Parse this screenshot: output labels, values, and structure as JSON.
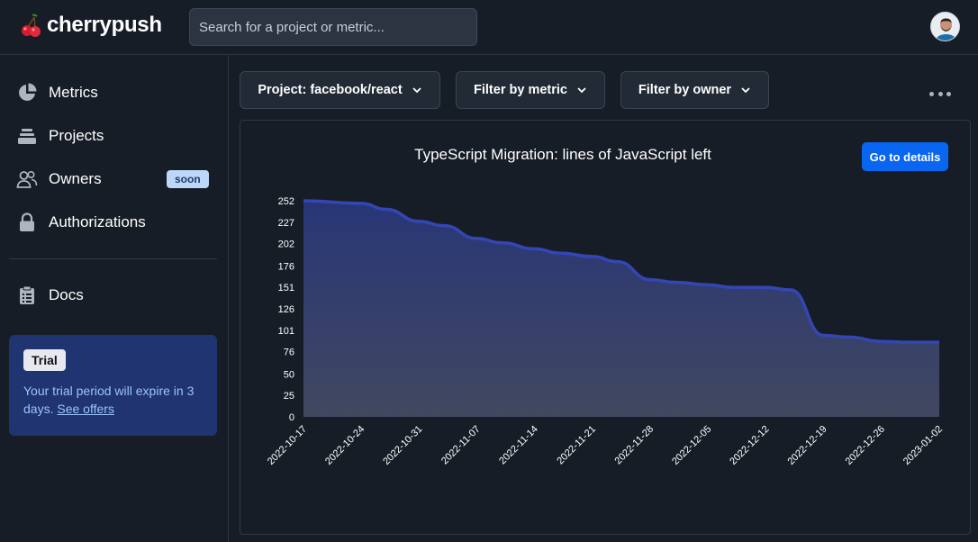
{
  "header": {
    "brand": "cherrypush",
    "search_placeholder": "Search for a project or metric..."
  },
  "sidebar": {
    "items": [
      {
        "label": "Metrics",
        "icon": "pie-chart-icon"
      },
      {
        "label": "Projects",
        "icon": "stack-icon"
      },
      {
        "label": "Owners",
        "icon": "users-icon",
        "badge": "soon"
      },
      {
        "label": "Authorizations",
        "icon": "lock-icon"
      },
      {
        "label": "Docs",
        "icon": "clipboard-icon"
      }
    ],
    "trial": {
      "badge": "Trial",
      "text": "Your trial period will expire in 3 days.",
      "link": "See offers"
    }
  },
  "filters": {
    "project": "Project: facebook/react",
    "metric": "Filter by metric",
    "owner": "Filter by owner"
  },
  "card": {
    "details_button": "Go to details"
  },
  "colors": {
    "accent": "#0866f0",
    "line": "#3446b4",
    "area_top": "#283677",
    "area_bottom": "#414860"
  },
  "chart_data": {
    "type": "area",
    "title": "TypeScript Migration: lines of JavaScript left",
    "xlabel": "",
    "ylabel": "",
    "x_ticks": [
      "2022-10-17",
      "2022-10-24",
      "2022-10-31",
      "2022-11-07",
      "2022-11-14",
      "2022-11-21",
      "2022-11-28",
      "2022-12-05",
      "2022-12-12",
      "2022-12-19",
      "2022-12-26",
      "2023-01-02"
    ],
    "y_ticks": [
      0,
      25,
      50,
      76,
      101,
      126,
      151,
      176,
      202,
      227,
      252
    ],
    "ylim": [
      0,
      252
    ],
    "grid": false,
    "legend": "none",
    "series": [
      {
        "x": [
          "2022-10-17",
          "2022-10-24",
          "2022-10-27",
          "2022-10-31",
          "2022-11-03",
          "2022-11-07",
          "2022-11-10",
          "2022-11-14",
          "2022-11-17",
          "2022-11-21",
          "2022-11-24",
          "2022-11-28",
          "2022-12-01",
          "2022-12-05",
          "2022-12-08",
          "2022-12-12",
          "2022-12-15",
          "2022-12-19",
          "2022-12-22",
          "2022-12-26",
          "2022-12-29",
          "2023-01-02"
        ],
        "values": [
          252,
          249,
          242,
          228,
          223,
          208,
          203,
          196,
          191,
          187,
          181,
          160,
          157,
          154,
          151,
          151,
          148,
          95,
          93,
          88,
          87,
          87
        ]
      }
    ]
  }
}
